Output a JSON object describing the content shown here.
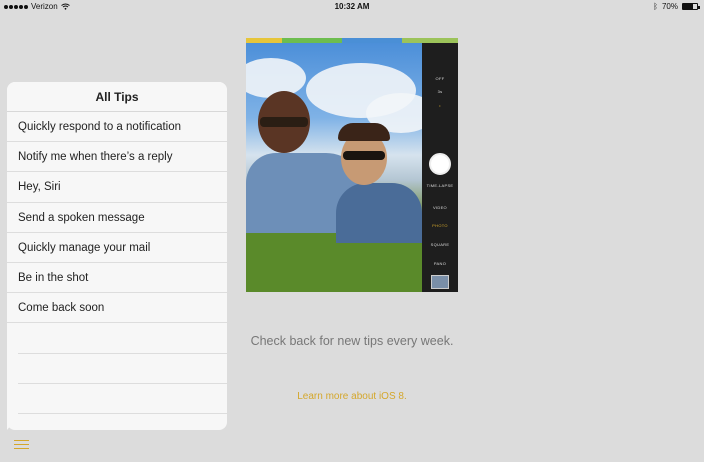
{
  "status_bar": {
    "carrier": "Verizon",
    "time": "10:32 AM",
    "battery": "70%",
    "battery_level": 0.7,
    "icons": [
      "signal-dots-icon",
      "wifi-icon",
      "bluetooth-icon",
      "battery-icon"
    ]
  },
  "tips": {
    "title": "All Tips",
    "items": [
      "Quickly respond to a notification",
      "Notify me when there’s a reply",
      "Hey, Siri",
      "Send a spoken message",
      "Quickly manage your mail",
      "Be in the shot",
      "Come back soon"
    ]
  },
  "camera": {
    "labels": {
      "off": "OFF",
      "timer": "3s",
      "time_lapse": "TIME-LAPSE",
      "video": "VIDEO",
      "photo": "PHOTO",
      "square": "SQUARE",
      "pano": "PANO"
    }
  },
  "main": {
    "check_back": "Check back for new tips every week.",
    "learn_more": "Learn more about iOS 8."
  },
  "colors": {
    "accent": "#d4a72c",
    "background": "#dcdcdc",
    "panel": "#f7f7f7"
  }
}
